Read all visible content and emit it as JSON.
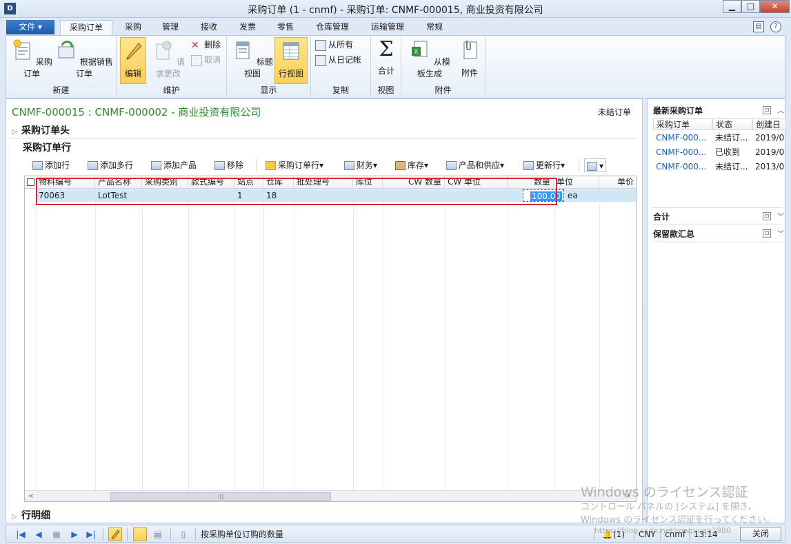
{
  "window": {
    "app_icon": "D",
    "title": "采购订单 (1 - cnmf) - 采购订单: CNMF-000015, 商业投资有限公司",
    "min": "▁",
    "max": "□",
    "close": "✕"
  },
  "ribbon_tabs": {
    "file": "文件 ▾",
    "tabs": [
      "采购订单",
      "采购",
      "管理",
      "接收",
      "发票",
      "零售",
      "仓库管理",
      "运输管理",
      "常规"
    ],
    "active_index": 0,
    "help": "?"
  },
  "ribbon": {
    "groups": {
      "new": {
        "label": "新建",
        "purchase_order": "采购订单",
        "from_sales_order": "根据销售订单"
      },
      "maintain": {
        "label": "维护",
        "edit": "编辑",
        "request_change": "请求更改",
        "delete": "删除",
        "cancel": "取消"
      },
      "show": {
        "label": "显示",
        "header_view": "标题视图",
        "line_view": "行视图"
      },
      "copy": {
        "label": "复制",
        "from_all": "从所有",
        "from_journal": "从日记帐"
      },
      "view": {
        "label": "视图",
        "totals": "合计"
      },
      "attachments": {
        "label": "附件",
        "generate_from_template": "从模板生成",
        "attachments": "附件"
      }
    }
  },
  "record": {
    "title": "CNMF-000015 : CNMF-000002 - 商业投资有限公司",
    "status": "未结订单"
  },
  "sections": {
    "header": "采购订单头",
    "lines": "采购订单行",
    "line_details": "行明细"
  },
  "line_toolbar": {
    "add_line": "添加行",
    "add_lines": "添加多行",
    "add_products": "添加产品",
    "remove": "移除",
    "purchase_order_line": "采购订单行▾",
    "financials": "财务▾",
    "inventory": "库存▾",
    "product_and_supply": "产品和供应▾",
    "update_line": "更新行▾",
    "extra": "▾"
  },
  "grid": {
    "columns": [
      "物料编号",
      "产品名称",
      "采购类别",
      "款式编号",
      "站点",
      "仓库",
      "批处理号",
      "库位",
      "CW 数量",
      "CW 单位",
      "数量",
      "单位",
      "单价"
    ],
    "rows": [
      {
        "item_number": "70063",
        "product_name": "LotTest",
        "procurement_category": "",
        "style": "",
        "site": "1",
        "warehouse": "18",
        "batch_number": "",
        "location": "",
        "cw_quantity": "",
        "cw_unit": "",
        "quantity": "100.00",
        "unit": "ea"
      }
    ],
    "scroll_grip": "|||",
    "scroll_left": "<",
    "scroll_right": ">"
  },
  "right_pane": {
    "latest_po": {
      "title": "最新采购订单",
      "columns": [
        "采购订单",
        "状态",
        "创建日"
      ],
      "rows": [
        {
          "po": "CNMF-000...",
          "status": "未结订...",
          "created": "2019/0"
        },
        {
          "po": "CNMF-000...",
          "status": "已收到",
          "created": "2019/0"
        },
        {
          "po": "CNMF-000...",
          "status": "未结订...",
          "created": "2013/0"
        }
      ]
    },
    "totals_title": "合计",
    "holdback_title": "保留款汇总"
  },
  "statusbar": {
    "hint": "按采购单位订购的数量",
    "notifications": "(1)",
    "currency": "CNY",
    "company": "cnmf",
    "time": "13:14",
    "close": "关闭"
  },
  "watermark": {
    "line1": "Windows のライセンス認証",
    "line2": "コントロール パネルの [システム] を開き、",
    "line3": "Windows のライセンス認証を行ってください。",
    "url": "https://blog.csdn.net/rongyuan1980"
  },
  "colors": {
    "accent_blue": "#1d5aad",
    "record_title_green": "#2e8b2e",
    "selection_yellow": "#f9cf58",
    "row_highlight": "#cfe7f7",
    "annotation_red": "#e0262b",
    "link_blue": "#1b62c4"
  }
}
